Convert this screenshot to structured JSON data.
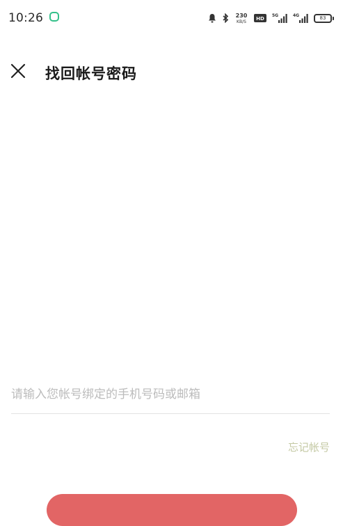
{
  "status_bar": {
    "time": "10:26",
    "net_speed_top": "230",
    "net_speed_bottom": "KB/S",
    "hd_badge": "HD",
    "battery_level": "83"
  },
  "header": {
    "title": "找回帐号密码"
  },
  "form": {
    "account_placeholder": "请输入您帐号绑定的手机号码或邮箱",
    "account_value": "",
    "forgot_account_label": "忘记帐号"
  },
  "colors": {
    "accent": "#e26565",
    "app_indicator": "#34c08a",
    "link": "#c4c9a4"
  }
}
